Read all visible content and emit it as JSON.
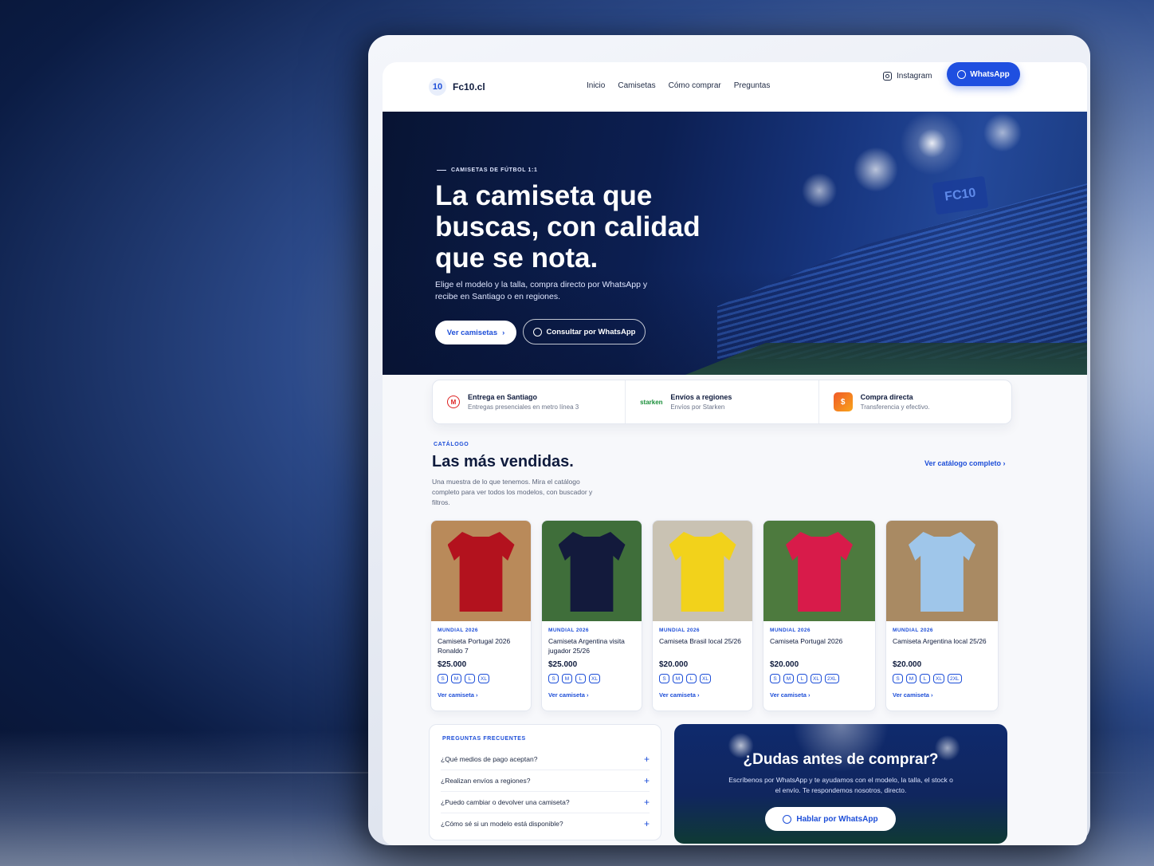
{
  "brand": {
    "name": "Fc10.cl",
    "mark": "10"
  },
  "nav": {
    "items": [
      "Inicio",
      "Camisetas",
      "Cómo comprar",
      "Preguntas"
    ],
    "instagram": "Instagram",
    "whatsapp": "WhatsApp"
  },
  "hero": {
    "eyebrow": "CAMISETAS DE FÚTBOL 1:1",
    "title": "La camiseta que buscas, con calidad que se nota.",
    "subtitle": "Elige el modelo y la talla, compra directo por WhatsApp y recibe en Santiago o en regiones.",
    "primary_button": "Ver camisetas",
    "secondary_button": "Consultar por WhatsApp",
    "sign_text": "FC10"
  },
  "features": [
    {
      "logo": "METRO",
      "title": "Entrega en Santiago",
      "desc": "Entregas presenciales en metro línea 3"
    },
    {
      "logo": "starken",
      "title": "Envíos a regiones",
      "desc": "Envíos por Starken"
    },
    {
      "logo": "CD",
      "title": "Compra directa",
      "desc": "Transferencia y efectivo."
    }
  ],
  "catalog": {
    "eyebrow": "CATÁLOGO",
    "title": "Las más vendidas.",
    "subtitle": "Una muestra de lo que tenemos. Mira el catálogo completo para ver todos los modelos, con buscador y filtros.",
    "link": "Ver catálogo completo",
    "products": [
      {
        "tag": "MUNDIAL 2026",
        "name": "Camiseta Portugal 2026 Ronaldo 7",
        "price": "$25.000",
        "sizes": [
          "S",
          "M",
          "L",
          "XL"
        ],
        "link": "Ver camiseta",
        "bg": "#b98a5a",
        "shirt": "#b3121e"
      },
      {
        "tag": "MUNDIAL 2026",
        "name": "Camiseta Argentina visita jugador 25/26",
        "price": "$25.000",
        "sizes": [
          "S",
          "M",
          "L",
          "XL"
        ],
        "link": "Ver camiseta",
        "bg": "#3f6e3a",
        "shirt": "#131a3c"
      },
      {
        "tag": "MUNDIAL 2026",
        "name": "Camiseta Brasil local 25/26",
        "price": "$20.000",
        "sizes": [
          "S",
          "M",
          "L",
          "XL"
        ],
        "link": "Ver camiseta",
        "bg": "#c9c2b3",
        "shirt": "#f2d21b"
      },
      {
        "tag": "MUNDIAL 2026",
        "name": "Camiseta Portugal 2026",
        "price": "$20.000",
        "sizes": [
          "S",
          "M",
          "L",
          "XL",
          "2XL"
        ],
        "link": "Ver camiseta",
        "bg": "#4d7a3e",
        "shirt": "#d81b4a"
      },
      {
        "tag": "MUNDIAL 2026",
        "name": "Camiseta Argentina local 25/26",
        "price": "$20.000",
        "sizes": [
          "S",
          "M",
          "L",
          "XL",
          "2XL"
        ],
        "link": "Ver camiseta",
        "bg": "#a98a63",
        "shirt": "#9fc6ea"
      }
    ]
  },
  "faq": {
    "eyebrow": "PREGUNTAS FRECUENTES",
    "items": [
      "¿Qué medios de pago aceptan?",
      "¿Realizan envíos a regiones?",
      "¿Puedo cambiar o devolver una camiseta?",
      "¿Cómo sé si un modelo está disponible?"
    ]
  },
  "cta": {
    "title": "¿Dudas antes de comprar?",
    "subtitle": "Escríbenos por WhatsApp y te ayudamos con el modelo, la talla, el stock o el envío. Te respondemos nosotros, directo.",
    "button": "Hablar por WhatsApp"
  }
}
